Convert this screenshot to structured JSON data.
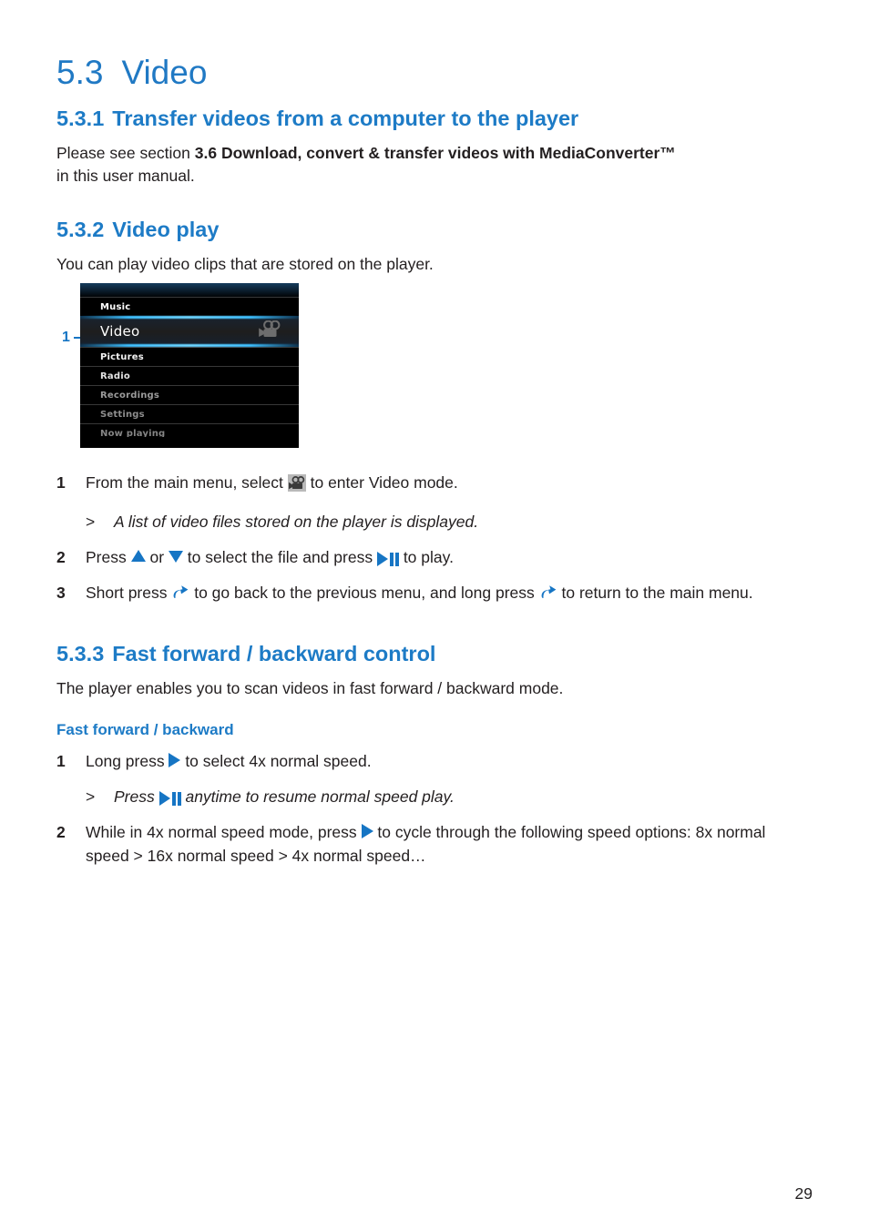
{
  "document": {
    "page_number": "29",
    "accent_color": "#1d7bc6",
    "text_color": "#231f20"
  },
  "section_main": {
    "number": "5.3",
    "title": "Video"
  },
  "section_531": {
    "number": "5.3.1",
    "title": "Transfer videos from a computer to the player",
    "body_prefix": "Please see section ",
    "body_bold": "3.6 Download, convert & transfer videos with MediaConverter™",
    "body_suffix": "in this user manual."
  },
  "section_532": {
    "number": "5.3.2",
    "title": "Video play",
    "intro": "You can play video clips that are stored on the player.",
    "figure": {
      "callout_number": "1",
      "menu_items": [
        {
          "label": "Music",
          "state": "normal",
          "icon": ""
        },
        {
          "label": "Video",
          "state": "selected",
          "icon": "camcorder-icon"
        },
        {
          "label": "Pictures",
          "state": "normal",
          "icon": ""
        },
        {
          "label": "Radio",
          "state": "normal",
          "icon": ""
        },
        {
          "label": "Recordings",
          "state": "dim",
          "icon": ""
        },
        {
          "label": "Settings",
          "state": "dim",
          "icon": ""
        },
        {
          "label": "Now playing",
          "state": "dim",
          "icon": ""
        }
      ]
    },
    "steps": [
      {
        "num": "1",
        "parts": [
          {
            "t": "text",
            "v": "From the main menu, select "
          },
          {
            "t": "icon",
            "v": "camcorder-icon"
          },
          {
            "t": "text",
            "v": " to enter Video mode."
          }
        ]
      },
      {
        "num": "2",
        "parts": [
          {
            "t": "text",
            "v": "Press "
          },
          {
            "t": "icon",
            "v": "triangle-up-icon"
          },
          {
            "t": "text",
            "v": " or "
          },
          {
            "t": "icon",
            "v": "triangle-down-icon"
          },
          {
            "t": "text",
            "v": " to select the file and press "
          },
          {
            "t": "icon",
            "v": "play-pause-icon"
          },
          {
            "t": "text",
            "v": " to play."
          }
        ]
      },
      {
        "num": "3",
        "parts": [
          {
            "t": "text",
            "v": "Short press "
          },
          {
            "t": "icon",
            "v": "back-arrow-icon"
          },
          {
            "t": "text",
            "v": " to go back to the previous menu, and long press "
          },
          {
            "t": "icon",
            "v": "back-arrow-icon"
          },
          {
            "t": "text",
            "v": " to return to the main menu."
          }
        ]
      }
    ],
    "note_after_step1": {
      "mark": ">",
      "text": "A list of video files stored on the player is displayed."
    }
  },
  "section_533": {
    "number": "5.3.3",
    "title": "Fast forward / backward control",
    "intro": "The player enables you to scan videos in fast forward / backward mode.",
    "subheading": "Fast forward / backward",
    "steps": [
      {
        "num": "1",
        "parts": [
          {
            "t": "text",
            "v": "Long press "
          },
          {
            "t": "icon",
            "v": "triangle-right-icon"
          },
          {
            "t": "text",
            "v": " to select 4x normal speed."
          }
        ]
      },
      {
        "num": "2",
        "parts": [
          {
            "t": "text",
            "v": "While in 4x normal speed mode, press "
          },
          {
            "t": "icon",
            "v": "triangle-right-icon"
          },
          {
            "t": "text",
            "v": " to cycle through the following speed options: 8x normal speed > 16x normal speed > 4x normal speed…"
          }
        ]
      }
    ],
    "note_after_step1": {
      "mark": ">",
      "prefix": "Press ",
      "icon": "play-pause-icon",
      "suffix": " anytime to resume normal speed play."
    }
  }
}
